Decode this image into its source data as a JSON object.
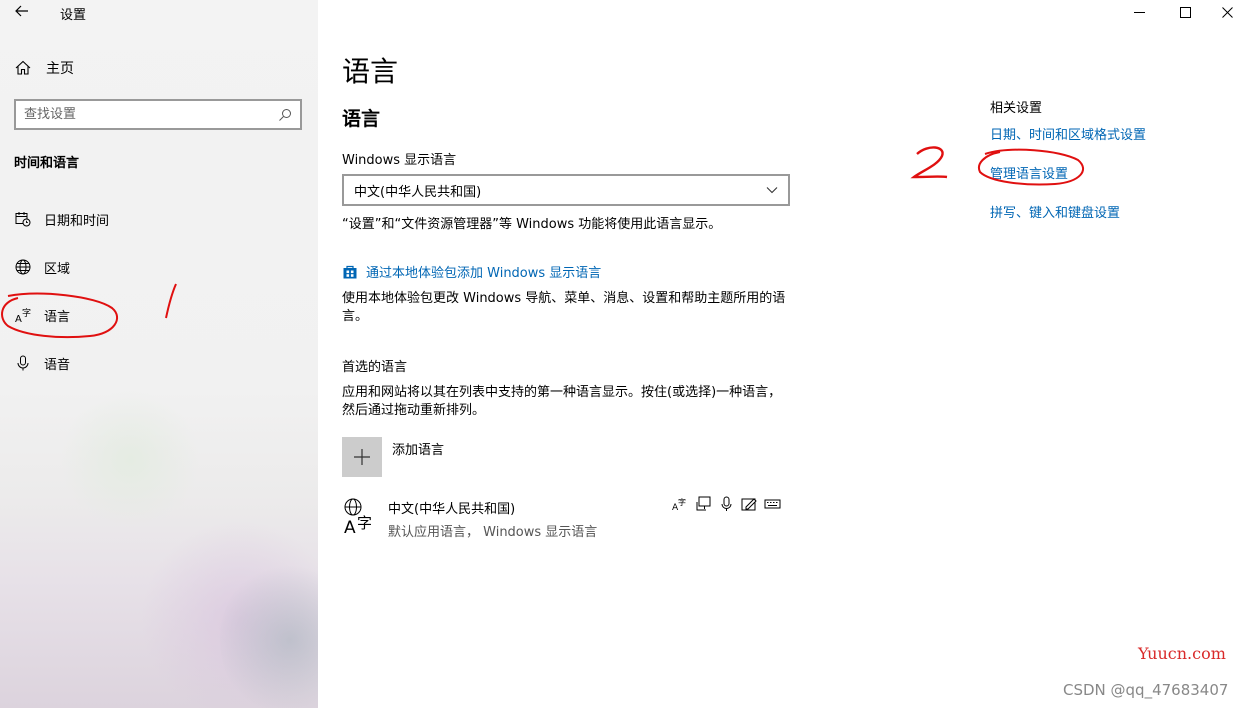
{
  "window": {
    "title": "设置",
    "controls": [
      "minimize",
      "maximize",
      "close"
    ]
  },
  "sidebar": {
    "back_icon": "back-arrow-icon",
    "home_label": "主页",
    "search_placeholder": "查找设置",
    "section_title": "时间和语言",
    "items": [
      {
        "label": "日期和时间",
        "icon": "calendar-clock-icon"
      },
      {
        "label": "区域",
        "icon": "globe-icon"
      },
      {
        "label": "语言",
        "icon": "language-icon"
      },
      {
        "label": "语音",
        "icon": "microphone-icon"
      }
    ]
  },
  "main": {
    "title": "语言",
    "subtitle": "语言",
    "display_language_label": "Windows 显示语言",
    "display_language_value": "中文(中华人民共和国)",
    "display_language_desc": "“设置”和“文件资源管理器”等 Windows 功能将使用此语言显示。",
    "experience_pack_link": "通过本地体验包添加 Windows 显示语言",
    "experience_pack_desc": "使用本地体验包更改 Windows 导航、菜单、消息、设置和帮助主题所用的语言。",
    "preferred_title": "首选的语言",
    "preferred_desc": "应用和网站将以其在列表中支持的第一种语言显示。按住(或选择)一种语言，然后通过拖动重新排列。",
    "add_language_label": "添加语言",
    "languages": [
      {
        "name": "中文(中华人民共和国)",
        "sub": "默认应用语言，  Windows 显示语言"
      }
    ]
  },
  "related": {
    "title": "相关设置",
    "links": [
      "日期、时间和区域格式设置",
      "管理语言设置",
      "拼写、键入和键盘设置"
    ]
  },
  "annotations": {
    "mark_1": "1",
    "mark_2": "2",
    "color": "#e01010"
  },
  "watermarks": {
    "site": "Yuucn.com",
    "csdn": "CSDN @qq_47683407"
  },
  "colors": {
    "link": "#0066b4",
    "sidebar_bg": "#f2f2f2"
  }
}
